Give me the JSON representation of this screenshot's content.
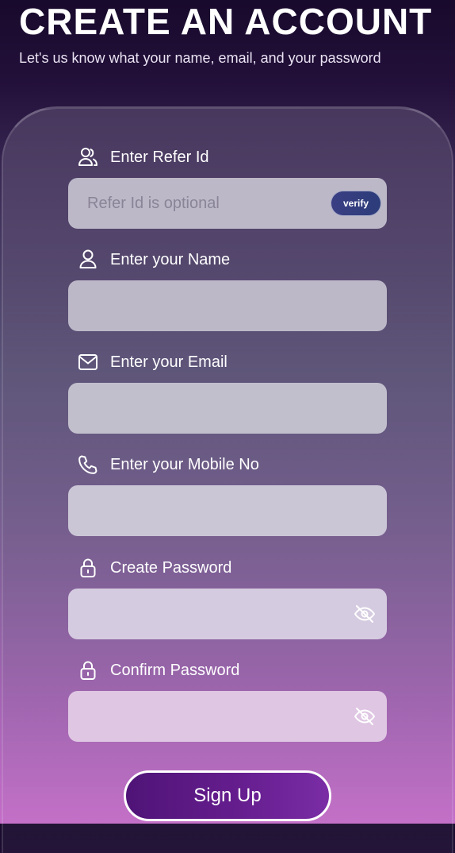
{
  "header": {
    "title": "CREATE AN ACCOUNT",
    "subtitle": "Let's us know what your name, email, and your password"
  },
  "form": {
    "fields": [
      {
        "label": "Enter Refer Id",
        "icon": "users-icon",
        "placeholder": "Refer Id is optional",
        "value": "",
        "input_bg": "#bcb8c8",
        "verify_label": "verify"
      },
      {
        "label": "Enter your Name",
        "icon": "user-icon",
        "placeholder": "",
        "value": "",
        "input_bg": "#bcb8c8"
      },
      {
        "label": "Enter your Email",
        "icon": "mail-icon",
        "placeholder": "",
        "value": "",
        "input_bg": "#c2bfcd"
      },
      {
        "label": "Enter your Mobile No",
        "icon": "phone-icon",
        "placeholder": "",
        "value": "",
        "input_bg": "#cbc6d6"
      },
      {
        "label": "Create Password",
        "icon": "lock-icon",
        "placeholder": "",
        "value": "",
        "input_bg": "#d5cbe0",
        "toggle_icon": "eye-off-icon"
      },
      {
        "label": "Confirm Password",
        "icon": "lock-icon",
        "placeholder": "",
        "value": "",
        "input_bg": "#dfc6e3",
        "toggle_icon": "eye-off-icon"
      }
    ],
    "submit_label": "Sign Up"
  },
  "colors": {
    "background_top": "#180a2c",
    "background_bottom": "#c46cc8",
    "verify_button": "#2c3c7a",
    "signup_button": "#651d8e",
    "text": "#ffffff"
  }
}
